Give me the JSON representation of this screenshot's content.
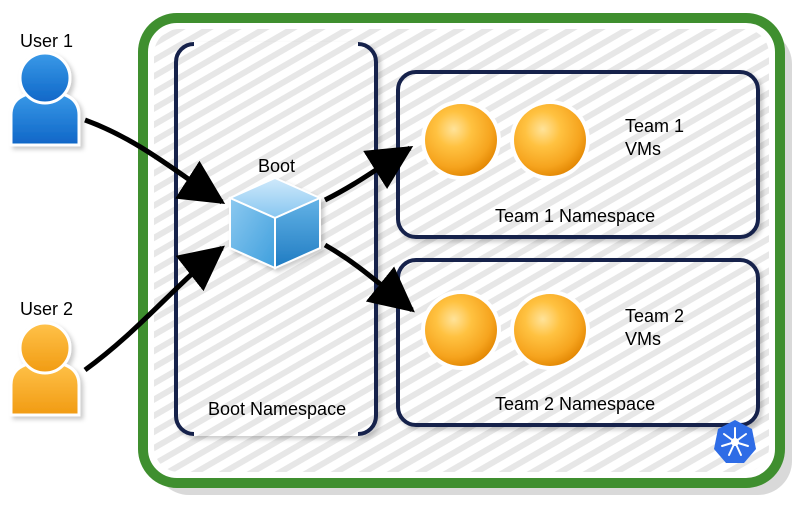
{
  "users": {
    "user1": {
      "label": "User 1"
    },
    "user2": {
      "label": "User 2"
    }
  },
  "boot": {
    "title": "Boot",
    "namespace_label": "Boot Namespace"
  },
  "teams": {
    "team1": {
      "vms_label": "Team 1\nVMs",
      "namespace_label": "Team 1 Namespace"
    },
    "team2": {
      "vms_label": "Team 2\nVMs",
      "namespace_label": "Team 2 Namespace"
    }
  }
}
